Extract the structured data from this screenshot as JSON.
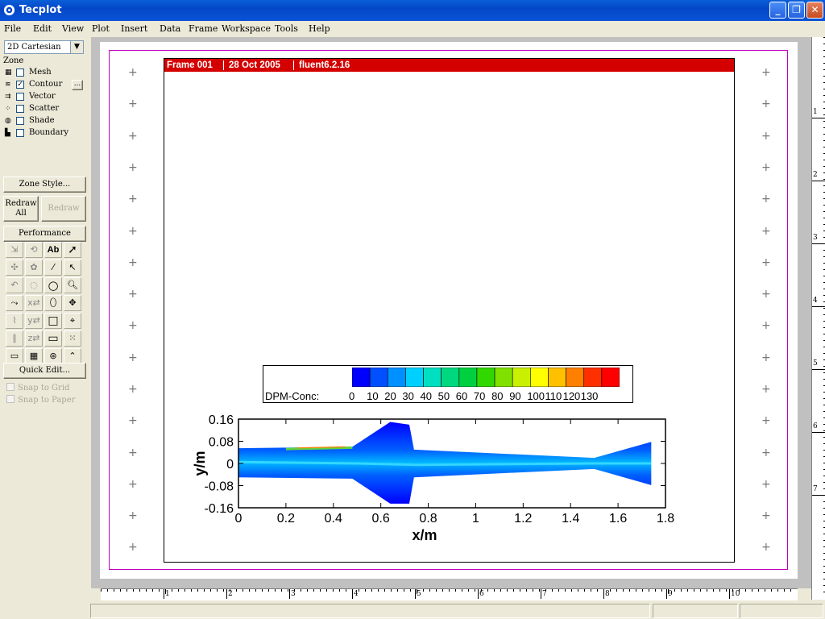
{
  "window": {
    "title": "Tecplot",
    "min": "_",
    "max": "❐",
    "close": "✕"
  },
  "menu": [
    "File",
    "Edit",
    "View",
    "Plot",
    "Insert",
    "Data",
    "Frame",
    "Workspace",
    "Tools",
    "Help"
  ],
  "sidebar": {
    "plot_type": "2D Cartesian",
    "zone_label": "Zone",
    "layers": [
      {
        "label": "Mesh",
        "checked": false,
        "icon": "mesh-icon"
      },
      {
        "label": "Contour",
        "checked": true,
        "icon": "contour-icon"
      },
      {
        "label": "Vector",
        "checked": false,
        "icon": "vector-icon"
      },
      {
        "label": "Scatter",
        "checked": false,
        "icon": "scatter-icon"
      },
      {
        "label": "Shade",
        "checked": false,
        "icon": "shade-icon"
      },
      {
        "label": "Boundary",
        "checked": false,
        "icon": "boundary-icon"
      }
    ],
    "contour_details": "...",
    "zone_style": "Zone Style...",
    "redraw_all": "Redraw All",
    "redraw": "Redraw",
    "performance": "Performance",
    "text_tool": "Ab",
    "quick_edit": "Quick Edit...",
    "snap_grid": "Snap to Grid",
    "snap_paper": "Snap to Paper"
  },
  "frame": {
    "name": "Frame 001",
    "date": "28 Oct 2005",
    "source": "fluent6.2.16"
  },
  "legend": {
    "title": "DPM-Conc:",
    "levels": [
      "0",
      "10",
      "20",
      "30",
      "40",
      "50",
      "60",
      "70",
      "80",
      "90",
      "100",
      "110",
      "120",
      "130"
    ],
    "colors": [
      "#0000ff",
      "#0050ff",
      "#0090ff",
      "#00d0ff",
      "#00e0c0",
      "#00d880",
      "#00d040",
      "#30d800",
      "#80e000",
      "#c8f000",
      "#ffff00",
      "#ffc000",
      "#ff8000",
      "#ff3000",
      "#ff0000"
    ]
  },
  "plot": {
    "xlabel": "x/m",
    "ylabel": "y/m",
    "xticks": [
      "0",
      "0.2",
      "0.4",
      "0.6",
      "0.8",
      "1",
      "1.2",
      "1.4",
      "1.6",
      "1.8"
    ],
    "yticks": [
      "0.16",
      "0.08",
      "0",
      "-0.08",
      "-0.16"
    ]
  },
  "chart_data": {
    "type": "heatmap",
    "title": "",
    "xlabel": "x/m",
    "ylabel": "y/m",
    "xlim": [
      0,
      1.8
    ],
    "ylim": [
      -0.16,
      0.16
    ],
    "colorbar_label": "DPM-Conc:",
    "colorbar_range": [
      0,
      130
    ],
    "geometry_outline": [
      {
        "x": 0.0,
        "y": 0.055
      },
      {
        "x": 0.48,
        "y": 0.06
      },
      {
        "x": 0.64,
        "y": 0.15
      },
      {
        "x": 0.72,
        "y": 0.14
      },
      {
        "x": 0.74,
        "y": 0.05
      },
      {
        "x": 1.5,
        "y": 0.02
      },
      {
        "x": 1.74,
        "y": 0.078
      },
      {
        "x": 1.74,
        "y": -0.078
      },
      {
        "x": 1.5,
        "y": -0.02
      },
      {
        "x": 0.74,
        "y": -0.05
      },
      {
        "x": 0.72,
        "y": -0.145
      },
      {
        "x": 0.64,
        "y": -0.145
      },
      {
        "x": 0.48,
        "y": -0.055
      },
      {
        "x": 0.0,
        "y": -0.05
      }
    ]
  },
  "rulers": {
    "bottom": [
      "1",
      "2",
      "3",
      "4",
      "5",
      "6",
      "7",
      "8",
      "9",
      "10"
    ],
    "right": [
      "1",
      "2",
      "3",
      "4",
      "5",
      "6",
      "7"
    ]
  }
}
